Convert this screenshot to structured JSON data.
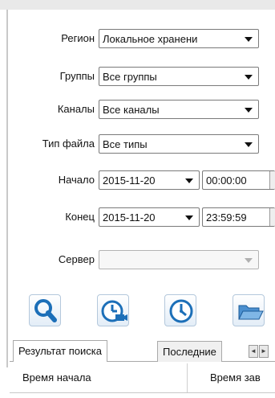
{
  "filters": {
    "region": {
      "label": "Регион",
      "value": "Локальное хранени"
    },
    "groups": {
      "label": "Группы",
      "value": "Все группы"
    },
    "channels": {
      "label": "Каналы",
      "value": "Все каналы"
    },
    "file_type": {
      "label": "Тип файла",
      "value": "Все типы"
    },
    "start": {
      "label": "Начало",
      "date": "2015-11-20",
      "time": "00:00:00"
    },
    "end": {
      "label": "Конец",
      "date": "2015-11-20",
      "time": "23:59:59"
    },
    "server": {
      "label": "Сервер",
      "value": ""
    }
  },
  "toolbar": {
    "icons": [
      "search-icon",
      "record-playback-icon",
      "time-clock-icon",
      "folder-open-icon"
    ]
  },
  "tabs": [
    {
      "label": "Результат поиска",
      "active": true
    },
    {
      "label": "Последние",
      "active": false
    }
  ],
  "tab_scroll": {
    "left": "◄",
    "right": "►"
  },
  "table": {
    "columns": [
      "Время начала",
      "Время зав"
    ]
  },
  "colors": {
    "accent": "#1c6fb8",
    "icon_fill": "#2b87d1"
  }
}
